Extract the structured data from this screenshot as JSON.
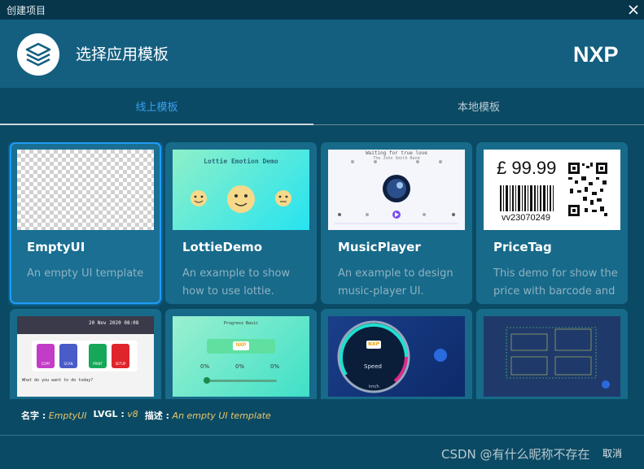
{
  "window": {
    "title": "创建项目"
  },
  "header": {
    "title": "选择应用模板",
    "brand": "NXP"
  },
  "tabs": [
    {
      "label": "线上模板",
      "active": true
    },
    {
      "label": "本地模板",
      "active": false
    }
  ],
  "cards": [
    {
      "name": "EmptyUI",
      "desc": "An empty UI template",
      "selected": true
    },
    {
      "name": "LottieDemo",
      "desc": "An example to show how to use lottie."
    },
    {
      "name": "MusicPlayer",
      "desc": "An example to design music-player UI."
    },
    {
      "name": "PriceTag",
      "desc": "This demo for show the price with barcode and"
    }
  ],
  "thumbs": {
    "lottie": {
      "title": "Lottie Emotion Demo"
    },
    "music": {
      "line1": "Waiting for true love",
      "line2": "The John Smith Band"
    },
    "price": {
      "price": "£ 99.99",
      "code": "vv23070249"
    },
    "widgets": {
      "date": "20 Nov 2020 08:08",
      "question": "What do you want to do today?",
      "buttons": [
        "COPY",
        "SCAN",
        "PRINT",
        "SETUP"
      ]
    },
    "progress": {
      "title": "Progress Basic",
      "badge": "NXP",
      "values": [
        "0%",
        "0%",
        "0%"
      ]
    },
    "gauge": {
      "label": "Speed",
      "unit": "km/h",
      "badge": "NXP"
    },
    "blueprint": {}
  },
  "info": {
    "name_label": "名字 :",
    "name_value": "EmptyUI",
    "lvgl_label": "LVGL :",
    "lvgl_value": "v8",
    "desc_label": "描述 :",
    "desc_value": "An empty UI template"
  },
  "footer": {
    "cancel_label": "取消",
    "watermark": "CSDN @有什么昵称不存在"
  },
  "colors": {
    "accent": "#1f9bf5",
    "header": "#145f80",
    "background": "#0b4a64",
    "card": "#176a8a",
    "highlight": "#e8c66a"
  }
}
